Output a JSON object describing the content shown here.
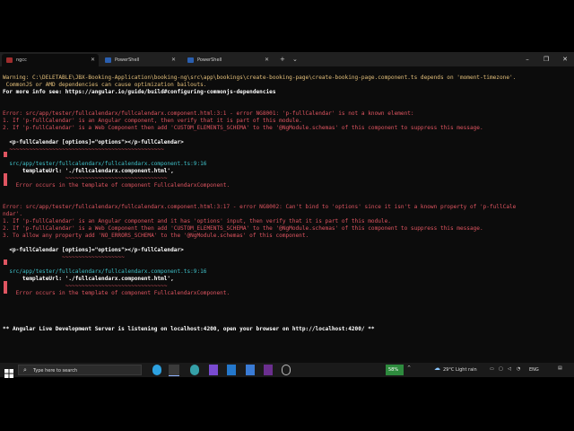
{
  "tabs": [
    {
      "label": "ngcc",
      "active": true,
      "icon_color": "#9f2d2d"
    },
    {
      "label": "PowerShell",
      "active": false,
      "icon_color": "#2a5fb0"
    },
    {
      "label": "PowerShell",
      "active": false,
      "icon_color": "#2a5fb0"
    }
  ],
  "tab_controls": {
    "new_tab": "+",
    "dropdown": "⌄"
  },
  "window_controls": {
    "minimize": "–",
    "maximize": "❐",
    "close": "✕"
  },
  "terminal": {
    "lines": [
      {
        "text": "Warning: C:\\DELETABLE\\JBX-Booking-Application\\booking-ng\\src\\app\\bookings\\create-booking-page\\create-booking-page.component.ts depends on 'moment-timezone'.",
        "cls": "y",
        "prefix": "Warning:"
      },
      {
        "text": " CommonJS or AMD dependencies can cause optimization bailouts.",
        "cls": "y"
      },
      {
        "text": "For more info see: https://angular.io/guide/build#configuring-commonjs-dependencies",
        "cls": "b"
      },
      {
        "text": "",
        "cls": ""
      },
      {
        "text": "",
        "cls": ""
      },
      {
        "text": "Error: src/app/tester/fullcalendarx/fullcalendarx.component.html:3:1 - error NG8001: 'p-fullCalendar' is not a known element:",
        "cls": "r"
      },
      {
        "text": "1. If 'p-fullCalendar' is an Angular component, then verify that it is part of this module.",
        "cls": "r"
      },
      {
        "text": "2. If 'p-fullCalendar' is a Web Component then add 'CUSTOM_ELEMENTS_SCHEMA' to the '@NgModule.schemas' of this component to suppress this message.",
        "cls": "r"
      },
      {
        "text": "",
        "cls": ""
      },
      {
        "text": "  <p-fullCalendar [options]=\"options\"></p-fullCalendar>",
        "cls": "b"
      },
      {
        "text": "  ~~~~~~~~~~~~~~~~~~~~~~~~~~~~~~~~~~~~~~~~~~~~~~~",
        "cls": "r"
      },
      {
        "text": "",
        "cls": ""
      },
      {
        "text": "  src/app/tester/fullcalendarx/fullcalendarx.component.ts:9:16",
        "cls": "c"
      },
      {
        "text": "      templateUrl: './fullcalendarx.component.html',",
        "cls": "b"
      },
      {
        "text": "                   ~~~~~~~~~~~~~~~~~~~~~~~~~~~~~~~",
        "cls": "r"
      },
      {
        "text": "    Error occurs in the template of component FullcalendarxComponent.",
        "cls": "r"
      },
      {
        "text": "",
        "cls": ""
      },
      {
        "text": "",
        "cls": ""
      },
      {
        "text": "Error: src/app/tester/fullcalendarx/fullcalendarx.component.html:3:17 - error NG8002: Can't bind to 'options' since it isn't a known property of 'p-fullCale",
        "cls": "r"
      },
      {
        "text": "ndar'.",
        "cls": "r"
      },
      {
        "text": "1. If 'p-fullCalendar' is an Angular component and it has 'options' input, then verify that it is part of this module.",
        "cls": "r"
      },
      {
        "text": "2. If 'p-fullCalendar' is a Web Component then add 'CUSTOM_ELEMENTS_SCHEMA' to the '@NgModule.schemas' of this component to suppress this message.",
        "cls": "r"
      },
      {
        "text": "3. To allow any property add 'NO_ERRORS_SCHEMA' to the '@NgModule.schemas' of this component.",
        "cls": "r"
      },
      {
        "text": "",
        "cls": ""
      },
      {
        "text": "  <p-fullCalendar [options]=\"options\"></p-fullCalendar>",
        "cls": "b"
      },
      {
        "text": "                  ~~~~~~~~~~~~~~~~~~~",
        "cls": "r"
      },
      {
        "text": "",
        "cls": ""
      },
      {
        "text": "  src/app/tester/fullcalendarx/fullcalendarx.component.ts:9:16",
        "cls": "c"
      },
      {
        "text": "      templateUrl: './fullcalendarx.component.html',",
        "cls": "b"
      },
      {
        "text": "                   ~~~~~~~~~~~~~~~~~~~~~~~~~~~~~~~",
        "cls": "r"
      },
      {
        "text": "    Error occurs in the template of component FullcalendarxComponent.",
        "cls": "r"
      },
      {
        "text": "",
        "cls": ""
      },
      {
        "text": "",
        "cls": ""
      },
      {
        "text": "",
        "cls": ""
      },
      {
        "text": "",
        "cls": ""
      },
      {
        "text": "** Angular Live Development Server is listening on localhost:4200, open your browser on http://localhost:4200/ **",
        "cls": "b"
      }
    ]
  },
  "taskbar": {
    "search_placeholder": "Type here to search",
    "battery": "58%",
    "weather": "29°C  Light rain",
    "language": "ENG"
  }
}
